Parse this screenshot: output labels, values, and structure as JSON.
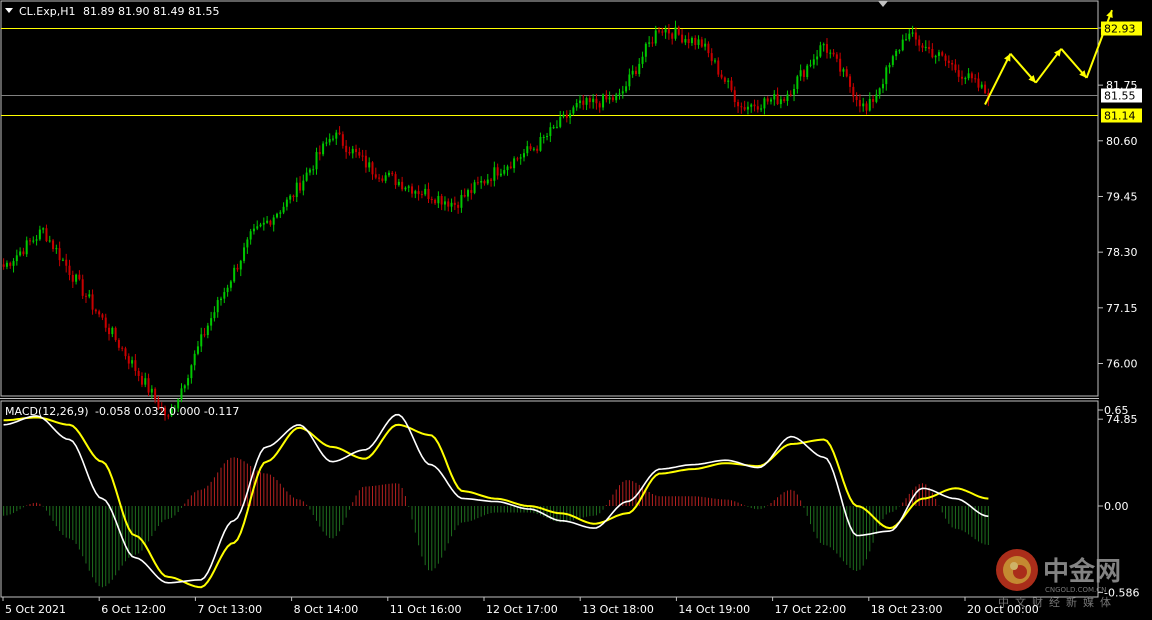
{
  "header": {
    "symbol": "CL.Exp,H1",
    "ohlc": "81.89 81.90 81.49 81.55",
    "menu_icon": "triangle-down-icon"
  },
  "macd_header": {
    "label": "MACD(12,26,9)",
    "values": "-0.058 0.032 0.000 -0.117"
  },
  "price_axis": {
    "ticks": [
      "82.93",
      "81.75",
      "80.60",
      "79.45",
      "78.30",
      "77.15",
      "76.00",
      "74.85"
    ],
    "tick_values": [
      82.93,
      81.75,
      80.6,
      79.45,
      78.3,
      77.15,
      76.0,
      74.85
    ],
    "current_price_tag": "81.55",
    "level_tags": [
      "82.93",
      "81.14"
    ]
  },
  "macd_axis": {
    "ticks": [
      "0.65",
      "0.00",
      "-0.586"
    ],
    "tick_values": [
      0.65,
      0.0,
      -0.586
    ]
  },
  "time_axis": {
    "labels": [
      "5 Oct 2021",
      "6 Oct 12:00",
      "7 Oct 13:00",
      "8 Oct 14:00",
      "11 Oct 16:00",
      "12 Oct 17:00",
      "13 Oct 18:00",
      "14 Oct 19:00",
      "17 Oct 22:00",
      "18 Oct 23:00",
      "20 Oct 00:00"
    ]
  },
  "watermark": {
    "brand": "中金网",
    "domain": "CNGOLD.COM.CN",
    "tagline": "中文财经新媒体"
  },
  "colors": {
    "background": "#000000",
    "bull_candle": "#00c800",
    "bear_candle": "#c80000",
    "level_line": "#ffff00",
    "current_line": "#808080",
    "macd_line": "#ffffff",
    "signal_line": "#ffff00",
    "hist_up": "#b42020",
    "hist_down": "#1e6e1e",
    "forecast_arrow": "#ffff00"
  },
  "chart_data": [
    {
      "type": "candlestick",
      "title": "CL.Exp,H1",
      "ylim": [
        74.6,
        83.3
      ],
      "horizontal_levels": [
        82.93,
        81.14
      ],
      "current_price": 81.55,
      "key_points": [
        {
          "x": "5 Oct 2021",
          "y": 78.0
        },
        {
          "x": "6 Oct 04:00",
          "y": 78.75
        },
        {
          "x": "6 Oct 12:00",
          "y": 77.4
        },
        {
          "x": "7 Oct 06:00",
          "y": 76.2
        },
        {
          "x": "7 Oct 08:00",
          "y": 74.85
        },
        {
          "x": "7 Oct 13:00",
          "y": 76.8
        },
        {
          "x": "8 Oct 02:00",
          "y": 78.6
        },
        {
          "x": "8 Oct 14:00",
          "y": 79.4
        },
        {
          "x": "8 Oct 21:00",
          "y": 80.75
        },
        {
          "x": "11 Oct 16:00",
          "y": 80.0
        },
        {
          "x": "12 Oct 10:00",
          "y": 79.6
        },
        {
          "x": "12 Oct 17:00",
          "y": 79.3
        },
        {
          "x": "13 Oct 10:00",
          "y": 80.0
        },
        {
          "x": "13 Oct 18:00",
          "y": 80.5
        },
        {
          "x": "14 Oct 19:00",
          "y": 81.3
        },
        {
          "x": "15 Oct 06:00",
          "y": 81.5
        },
        {
          "x": "17 Oct 22:00",
          "y": 82.95
        },
        {
          "x": "18 Oct 06:00",
          "y": 82.6
        },
        {
          "x": "18 Oct 12:00",
          "y": 81.3
        },
        {
          "x": "18 Oct 23:00",
          "y": 81.5
        },
        {
          "x": "19 Oct 10:00",
          "y": 82.6
        },
        {
          "x": "19 Oct 14:00",
          "y": 81.2
        },
        {
          "x": "19 Oct 20:00",
          "y": 82.8
        },
        {
          "x": "20 Oct 00:00",
          "y": 82.2
        },
        {
          "x": "20 Oct 06:00",
          "y": 81.55
        }
      ],
      "forecast_zigzag": [
        81.35,
        82.4,
        81.8,
        82.5,
        81.9,
        83.3
      ]
    },
    {
      "type": "line",
      "title": "MACD(12,26,9)",
      "ylim": [
        -0.586,
        0.65
      ],
      "series": [
        {
          "name": "MACD",
          "values": [
            0.55,
            0.61,
            0.45,
            0.05,
            -0.35,
            -0.52,
            -0.5,
            -0.1,
            0.4,
            0.55,
            0.3,
            0.38,
            0.62,
            0.28,
            0.05,
            0.03,
            -0.02,
            -0.1,
            -0.15,
            0.03,
            0.25,
            0.28,
            0.31,
            0.26,
            0.47,
            0.33,
            -0.2,
            -0.17,
            0.12,
            0.05,
            -0.07
          ]
        },
        {
          "name": "Signal",
          "values": [
            0.58,
            0.6,
            0.55,
            0.3,
            -0.2,
            -0.48,
            -0.55,
            -0.25,
            0.3,
            0.53,
            0.4,
            0.32,
            0.55,
            0.48,
            0.1,
            0.05,
            0.0,
            -0.05,
            -0.12,
            -0.05,
            0.22,
            0.25,
            0.29,
            0.27,
            0.42,
            0.45,
            0.0,
            -0.15,
            0.05,
            0.12,
            0.05
          ]
        }
      ]
    }
  ]
}
